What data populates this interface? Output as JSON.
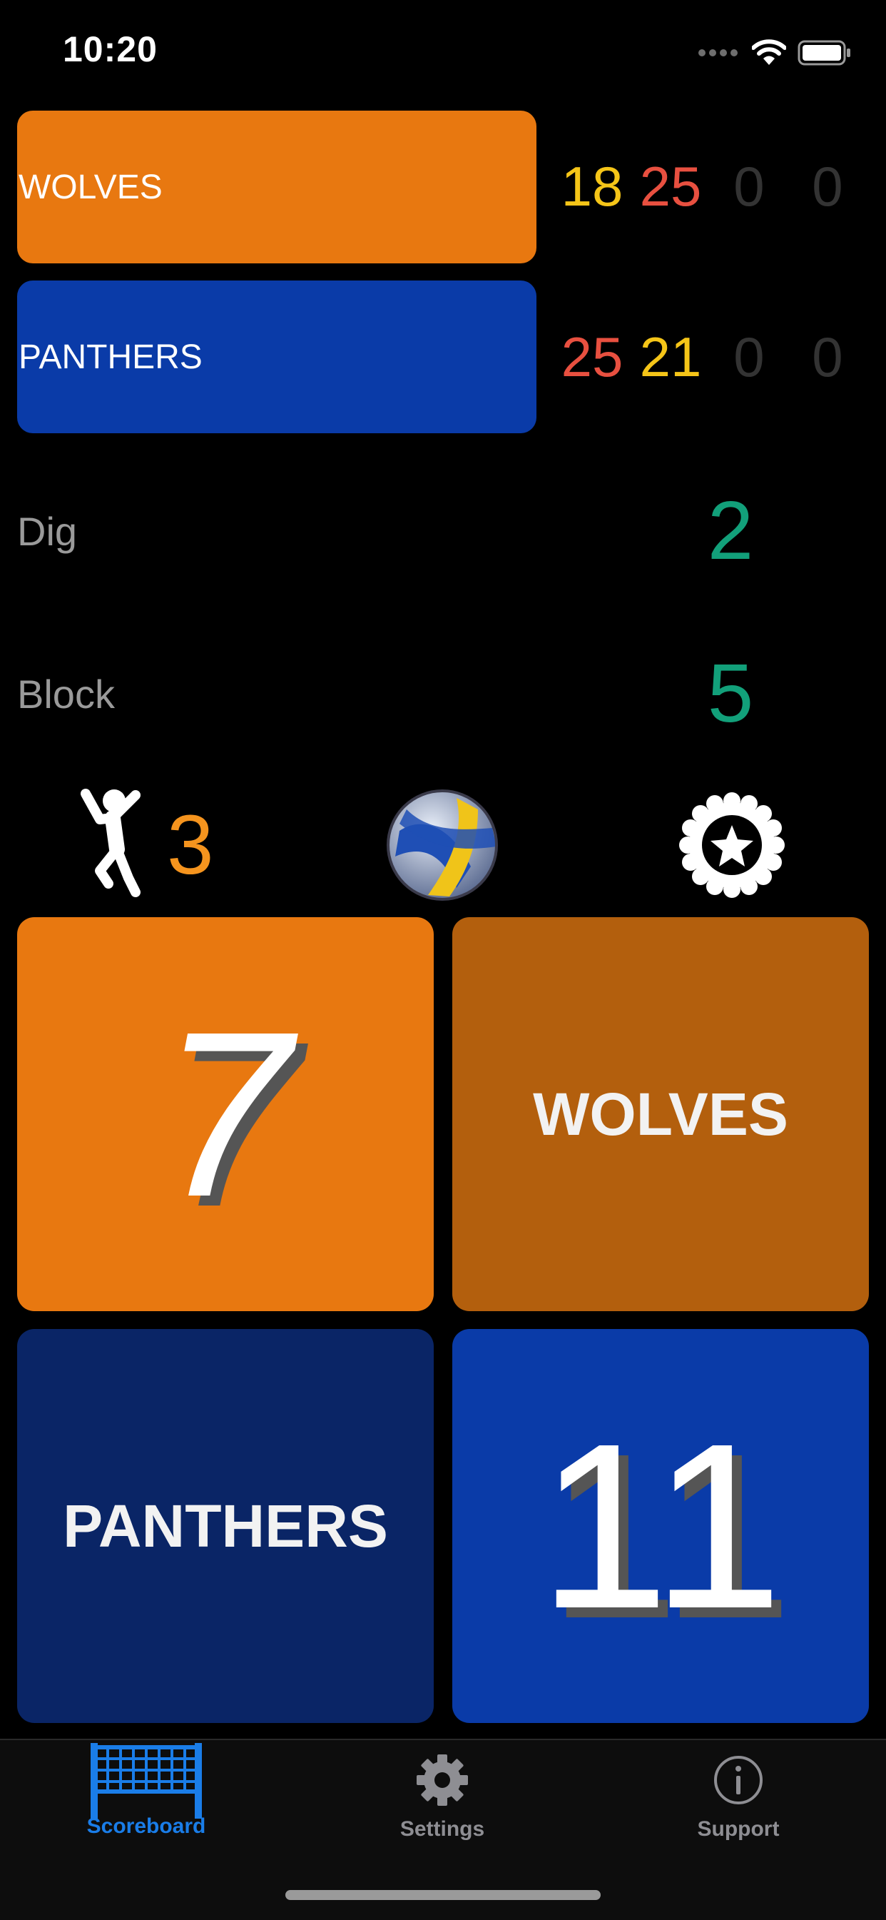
{
  "status": {
    "time": "10:20"
  },
  "teams": [
    {
      "name": "WOLVES",
      "color": "#e87810",
      "sets": [
        "18",
        "25",
        "0",
        "0"
      ],
      "set_colors": [
        "#f5c518",
        "#e85040",
        "#333333",
        "#333333"
      ]
    },
    {
      "name": "PANTHERS",
      "color": "#0a3ba8",
      "sets": [
        "25",
        "21",
        "0",
        "0"
      ],
      "set_colors": [
        "#e85040",
        "#f5c518",
        "#333333",
        "#333333"
      ]
    }
  ],
  "stats": [
    {
      "label": "Dig",
      "value": "2"
    },
    {
      "label": "Block",
      "value": "5"
    }
  ],
  "controls": {
    "player_count": "3"
  },
  "scoreboard": {
    "wolves_score": "7",
    "wolves_label": "WOLVES",
    "panthers_label": "PANTHERS",
    "panthers_score": "11"
  },
  "tabs": [
    {
      "label": "Scoreboard",
      "icon": "volleyball-net-icon",
      "active": true
    },
    {
      "label": "Settings",
      "icon": "gear-icon",
      "active": false
    },
    {
      "label": "Support",
      "icon": "info-icon",
      "active": false
    }
  ],
  "colors": {
    "accent": "#1a7de8",
    "stat_green": "#12a07a",
    "player_orange": "#f5941e"
  }
}
